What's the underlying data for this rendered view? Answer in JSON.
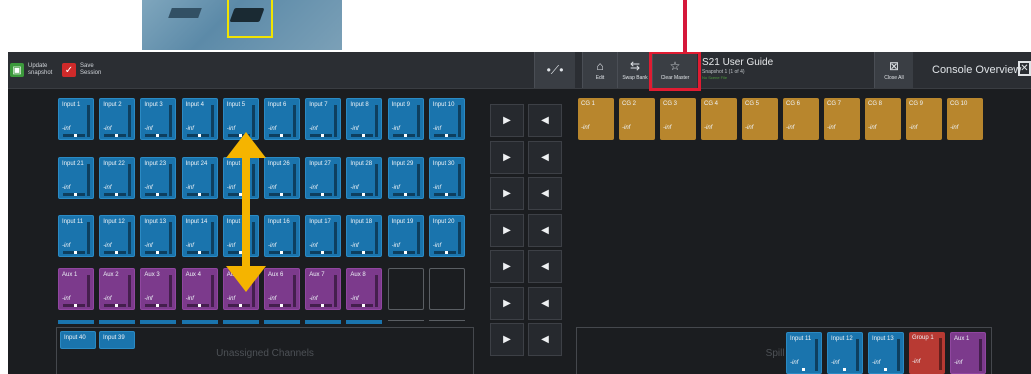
{
  "toolbar": {
    "update_label": "Update\nsnapshot",
    "save_label": "Save\nSession",
    "edit_label": "Edit",
    "swap_label": "Swap Bank",
    "clear_master_label": "Clear Master",
    "close_all_label": "Close All",
    "title": "S21 User Guide",
    "subtitle": "Snapshot 1 (1 of 4)",
    "subtitle_small": "No Scene File",
    "console_overview": "Console Overview"
  },
  "inf": "-inf",
  "row1": [
    "Input 1",
    "Input 2",
    "Input 3",
    "Input 4",
    "Input 5",
    "Input 6",
    "Input 7",
    "Input 8",
    "Input 9",
    "Input 10"
  ],
  "row2": [
    "Input 21",
    "Input 22",
    "Input 23",
    "Input 24",
    "Input 25",
    "Input 26",
    "Input 27",
    "Input 28",
    "Input 29",
    "Input 30"
  ],
  "row3": [
    "Input 11",
    "Input 12",
    "Input 13",
    "Input 14",
    "Input 15",
    "Input 16",
    "Input 17",
    "Input 18",
    "Input 19",
    "Input 20"
  ],
  "row4": [
    "Aux 1",
    "Aux 2",
    "Aux 3",
    "Aux 4",
    "Aux 5",
    "Aux 6",
    "Aux 7",
    "Aux 8"
  ],
  "unassigned": {
    "label": "Unassigned Channels",
    "items": [
      "Input 40",
      "Input 39"
    ]
  },
  "cg": [
    "CG 1",
    "CG 2",
    "CG 3",
    "CG 4",
    "CG 5",
    "CG 6",
    "CG 7",
    "CG 8",
    "CG 9",
    "CG 10"
  ],
  "spill": {
    "label": "Spill Set",
    "items": [
      "Input 11",
      "Input 12",
      "Input 13",
      "Group 1",
      "Aux 1"
    ]
  },
  "nav_right": "▶",
  "nav_left": "◀",
  "colors": {
    "input": "#1a74ad",
    "aux": "#7c3a8c",
    "cg": "#b8862d",
    "group": "#b83a33",
    "highlight": "#e01c32",
    "arrow": "#f5b400"
  },
  "icons": [
    "update-snapshot-icon",
    "save-session-icon",
    "routing-icon",
    "edit-icon",
    "swap-bank-icon",
    "star-icon",
    "close-all-icon",
    "close-icon"
  ]
}
